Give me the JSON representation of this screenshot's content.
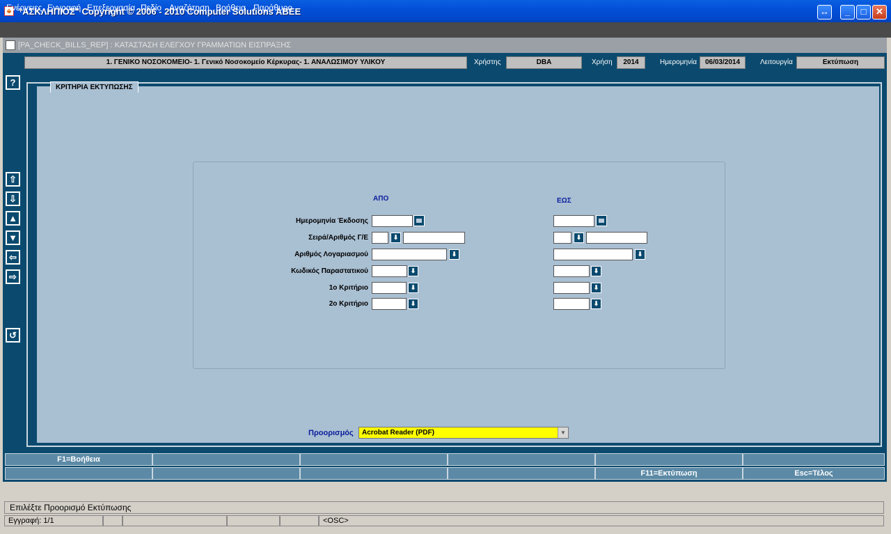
{
  "window": {
    "title": "\"ΑΣΚΛΗΠΙΟΣ\" Copyright © 2006 - 2010 Computer Solutions ABEE",
    "buttons": {
      "resize": "↔",
      "minimize": "_",
      "maximize": "□",
      "close": "✕"
    }
  },
  "menu": {
    "items": [
      "Ενέργειες",
      "Εγγραφή",
      "Επεξεργασία",
      "Πεδίο",
      "Αναζήτηση",
      "Βοήθεια",
      "Παράθυρο"
    ]
  },
  "form": {
    "title": "[PA_CHECK_BILLS_REP]  :  ΚΑΤΑΣΤΑΣΗ ΕΛΕΓΧΟΥ ΓΡΑΜΜΑΤΙΩΝ ΕΙΣΠΡΑΞΗΣ"
  },
  "header": {
    "organization": "1. ΓΕΝΙΚΟ ΝΟΣΟΚΟΜΕΙΟ- 1. Γενικό Νοσοκομείο Κέρκυρας- 1. ΑΝΑΛΩΣΙΜΟΥ ΥΛΙΚΟΥ",
    "user_label": "Χρήστης",
    "user_value": "DBA",
    "year_label": "Χρήση",
    "year_value": "2014",
    "date_label": "Ημερομηνία",
    "date_value": "06/03/2014",
    "function_label": "Λειτουργία",
    "function_value": "Εκτύπωση"
  },
  "toolbar": {
    "help": "?",
    "first": "⇧",
    "last": "⇩",
    "prev": "▲",
    "next": "▼",
    "back": "⇦",
    "forward": "⇨",
    "undo": "↺"
  },
  "criteria": {
    "tab_title": "ΚΡΙΤΗΡΙΑ ΕΚΤΥΠΩΣΗΣ",
    "from_header": "ΑΠΟ",
    "to_header": "ΕΩΣ",
    "fields": [
      {
        "label": "Ημερομηνία Έκδοσης"
      },
      {
        "label": "Σειρά/Αριθμός Γ/Ε"
      },
      {
        "label": "Αριθμός Λογαριασμού"
      },
      {
        "label": "Κωδικός Παραστατικού"
      },
      {
        "label": "1ο Κριτήριο"
      },
      {
        "label": "2ο Κριτήριο"
      }
    ],
    "destination_label": "Προορισμός",
    "destination_value": "Acrobat Reader (PDF)"
  },
  "function_keys": {
    "row1": [
      "F1=Βοήθεια",
      "",
      "",
      "",
      "",
      ""
    ],
    "row2": [
      "",
      "",
      "",
      "",
      "F11=Εκτύπωση",
      "Esc=Τέλος"
    ]
  },
  "status": {
    "message": "Επιλέξτε Προορισμό Εκτύπωσης",
    "record": "Εγγραφή: 1/1",
    "mode": "<OSC>"
  }
}
